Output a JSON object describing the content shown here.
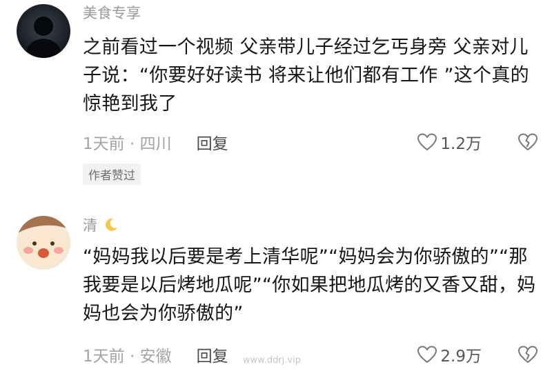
{
  "comments": [
    {
      "username": "美食专享",
      "avatar_icon": "dark-silhouette-avatar",
      "text": "之前看过一个视频 父亲带儿子经过乞丐身旁 父亲对儿子说：“你要好好读书 将来让他们都有工作 ”这个真的惊艳到我了",
      "time_location": "1天前 · 四川",
      "reply_label": "回复",
      "like_count": "1.2万",
      "badge": "作者赞过"
    },
    {
      "username": "清",
      "username_icon": "crescent-moon-icon",
      "avatar_icon": "cartoon-face-avatar",
      "text": "“妈妈我以后要是考上清华呢”“妈妈会为你骄傲的”“那我要是以后烤地瓜呢”“你如果把地瓜烤的又香又甜，妈妈也会为你骄傲的”",
      "time_location": "1天前 · 安徽",
      "reply_label": "回复",
      "like_count": "2.9万"
    }
  ],
  "watermark": "www.ddrj.vip",
  "colors": {
    "body_text": "#161616",
    "meta_text": "#a3a3a3",
    "username": "#9a9a9a",
    "moon": "#f2c94c"
  }
}
